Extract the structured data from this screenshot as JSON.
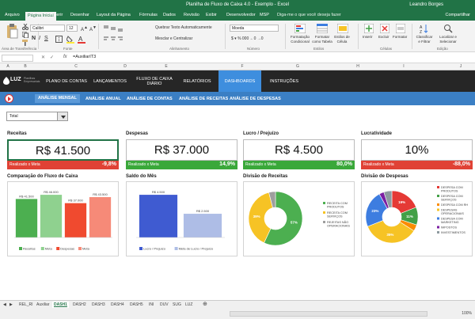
{
  "window": {
    "title": "Planilha de Fluxo de Caixa 4.0 - Exemplo  -  Excel",
    "user": "Leandro Borges"
  },
  "ribbon_tabs": [
    "Arquivo",
    "Página Inicial",
    "Inserir",
    "Desenhar",
    "Layout da Página",
    "Fórmulas",
    "Dados",
    "Revisão",
    "Exibir",
    "Desenvolvedor",
    "MSP"
  ],
  "tell_me": "Diga-me o que você deseja fazer",
  "share": "Compartilhar",
  "ribbon": {
    "font_name": "Calibri",
    "font_size": "12",
    "wrap_text": "Quebrar Texto Automaticamente",
    "merge_center": "Mesclar e Centralizar",
    "number_format": "Moeda",
    "conditional_format": "Formatação Condicional",
    "format_table": "Formatar como Tabela",
    "cell_styles": "Estilos de Célula",
    "insert": "Inserir",
    "delete": "Excluir",
    "format": "Formatar",
    "sort_filter": "Classificar e Filtrar",
    "find_select": "Localizar e Selecionar",
    "groups": {
      "clipboard": "Área de Transferência",
      "font": "Fonte",
      "alignment": "Alinhamento",
      "number": "Número",
      "styles": "Estilos",
      "cells": "Células",
      "editing": "Edição"
    }
  },
  "formula_bar": {
    "name_box": "",
    "fx": "fx",
    "formula": "=AuxiliarIT3"
  },
  "columns": [
    "A",
    "B",
    "C",
    "D",
    "E",
    "F",
    "G",
    "H",
    "I",
    "J"
  ],
  "app_nav": {
    "logo": "LUZ",
    "logo_sub": "Planilhas Empresariais",
    "items": [
      "PLANO DE CONTAS",
      "LANÇAMENTOS",
      "FLUXO DE CAIXA DIÁRIO",
      "RELATÓRIOS",
      "DASHBOARDS",
      "INSTRUÇÕES"
    ],
    "active": "DASHBOARDS"
  },
  "sub_nav": [
    "ANÁLISE MENSAL",
    "ANÁLISE ANUAL",
    "ANÁLISE DE CONTAS",
    "ANÁLISE DE RECEITAS",
    "ANÁLISE DE DESPESAS"
  ],
  "filter": {
    "value": "Total"
  },
  "kpis": [
    {
      "label": "Receitas",
      "value": "R$ 41.500",
      "bar_label": "Realizado x Meta",
      "pct": "-9,8%",
      "status": "negative"
    },
    {
      "label": "Despesas",
      "value": "R$ 37.000",
      "bar_label": "Realizado x Meta",
      "pct": "14,9%",
      "status": "positive"
    },
    {
      "label": "Lucro / Prejuízo",
      "value": "R$ 4.500",
      "bar_label": "Realizado x Meta",
      "pct": "80,0%",
      "status": "positive"
    },
    {
      "label": "Lucratividade",
      "value": "10%",
      "bar_label": "Realizado x Meta",
      "pct": "-88,0%",
      "status": "negative"
    }
  ],
  "chart_data": [
    {
      "type": "bar",
      "title": "Comparação do Fluxo de Caixa",
      "categories": [
        "Receitas",
        "Meta",
        "Despesas",
        "Meta"
      ],
      "values": [
        41500,
        46000,
        37000,
        43500
      ],
      "labels": [
        "R$ 41.500",
        "R$ 46.000",
        "R$ 37.000",
        "R$ 43.500"
      ],
      "colors": [
        "#4caf50",
        "#8fd18f",
        "#f04a2f",
        "#f68a78"
      ],
      "legend": [
        "Receitas",
        "Meta",
        "Despesas",
        "Meta"
      ]
    },
    {
      "type": "bar",
      "title": "Saldo do Mês",
      "categories": [
        "Lucro / Prejuízo",
        "Meta de Lucro / Prejuízo"
      ],
      "values": [
        4500,
        2500
      ],
      "labels": [
        "R$ 4.500",
        "R$ 2.500"
      ],
      "colors": [
        "#3f5bd1",
        "#aebde6"
      ],
      "legend": [
        "Lucro / Prejuízo",
        "Meta de Lucro / Prejuízo"
      ]
    },
    {
      "type": "pie",
      "title": "Divisão de Receitas",
      "series": [
        {
          "name": "RECEITA COM PRODUTOS",
          "value": 57,
          "label": "57%",
          "color": "#4caf50"
        },
        {
          "name": "RECEITA COM SERVIÇOS",
          "value": 39,
          "label": "39%",
          "color": "#f6c325"
        },
        {
          "name": "REJEITAS NÃO OPERACIONAIS",
          "value": 4,
          "label": "",
          "color": "#9e9e9e"
        }
      ]
    },
    {
      "type": "pie",
      "title": "Divisão de Despesas",
      "series": [
        {
          "name": "DESPESA COM PRODUTOS",
          "value": 19,
          "label": "19%",
          "color": "#e53935"
        },
        {
          "name": "DESPESA COM SERVIÇOS",
          "value": 11,
          "label": "11%",
          "color": "#43a047"
        },
        {
          "name": "DESPESA COM RH",
          "value": 4,
          "label": "",
          "color": "#fb8c00"
        },
        {
          "name": "DESPESAS OPERACIONAIS",
          "value": 35,
          "label": "35%",
          "color": "#f6c325"
        },
        {
          "name": "DESPESA COM MARKETING",
          "value": 23,
          "label": "23%",
          "color": "#3d7de0"
        },
        {
          "name": "IMPOSTOS",
          "value": 3,
          "label": "",
          "color": "#7b1fa2"
        },
        {
          "name": "INVESTIMENTOS",
          "value": 5,
          "label": "",
          "color": "#8d9a9f"
        }
      ]
    }
  ],
  "sheet_tabs": [
    "REL_RI",
    "Auxiliar",
    "DASH1",
    "DASH2",
    "DASH3",
    "DASH4",
    "DASH5",
    "INI",
    "DUV",
    "SUG",
    "LUZ"
  ],
  "active_sheet": "DASH1",
  "status": {
    "zoom": "100%"
  }
}
